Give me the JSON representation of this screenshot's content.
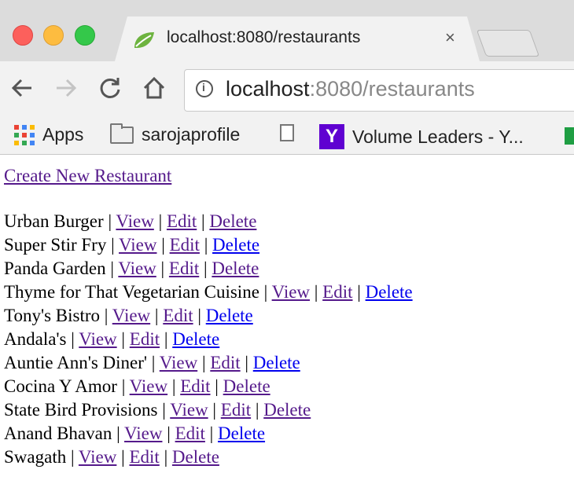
{
  "browser": {
    "tab_title": "localhost:8080/restaurants",
    "tab_close": "×",
    "url_host": "localhost",
    "url_path": ":8080/restaurants",
    "bookmarks": [
      "Apps",
      "sarojaprofile",
      "",
      "Volume Leaders - Y..."
    ]
  },
  "page": {
    "create_link": "Create New Restaurant ",
    "separator": " | ",
    "actions": {
      "view": "View",
      "edit": "Edit",
      "delete": "Delete"
    },
    "restaurants": [
      "Urban Burger",
      "Super Stir Fry",
      "Panda Garden",
      "Thyme for That Vegetarian Cuisine",
      "Tony's Bistro",
      "Andala's",
      "Auntie Ann's Diner'",
      "Cocina Y Amor",
      "State Bird Provisions",
      "Anand Bhavan",
      "Swagath"
    ]
  },
  "colors": {
    "visited_link": "#551a8b",
    "unvisited_link": "#0000ee"
  }
}
